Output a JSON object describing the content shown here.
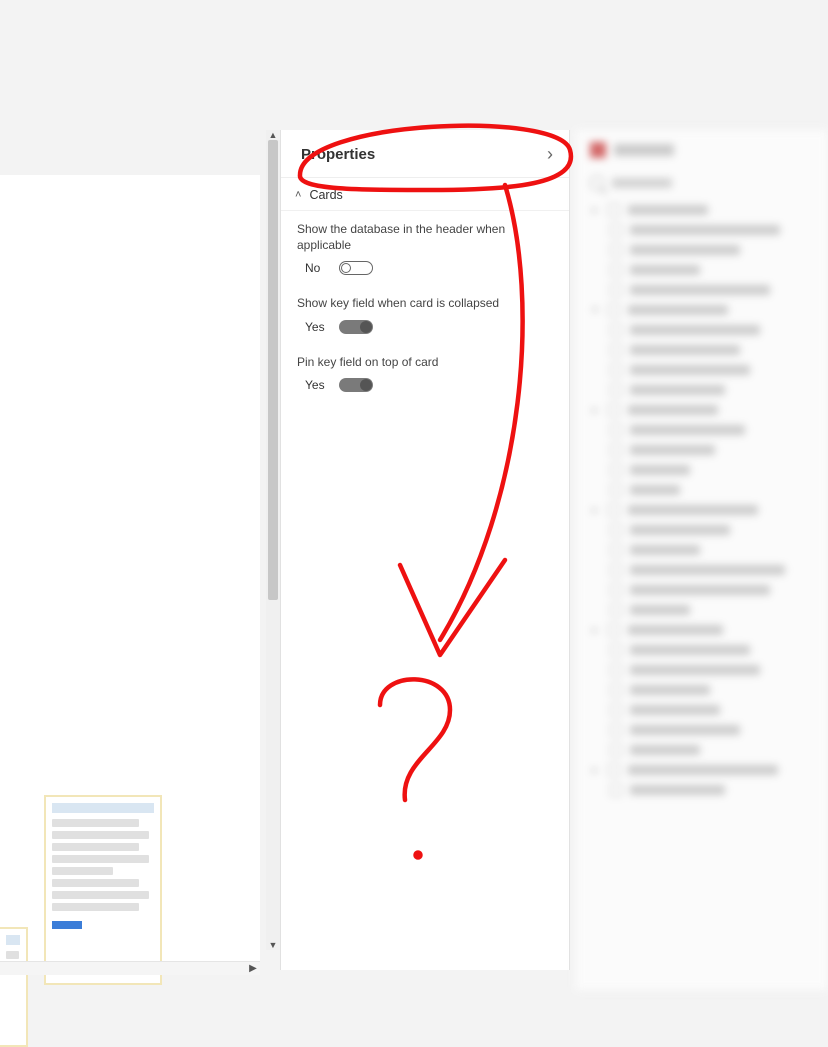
{
  "panel": {
    "title": "Properties",
    "sections": {
      "cards": {
        "title": "Cards",
        "settings": [
          {
            "label": "Show the database in the header when applicable",
            "stateLabel": "No",
            "on": false
          },
          {
            "label": "Show key field when card is collapsed",
            "stateLabel": "Yes",
            "on": true
          },
          {
            "label": "Pin key field on top of card",
            "stateLabel": "Yes",
            "on": true
          }
        ]
      }
    }
  }
}
